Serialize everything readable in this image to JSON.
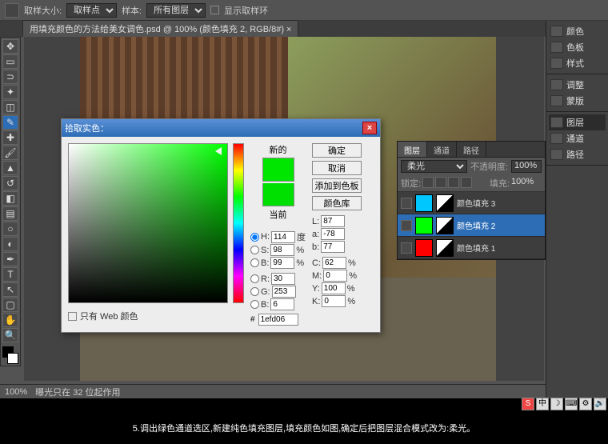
{
  "topbar": {
    "sample_size_label": "取样大小:",
    "sample_size_value": "取样点",
    "sample_label": "样本:",
    "sample_value": "所有图层",
    "show_ring": "显示取样环"
  },
  "doc": {
    "title": "用填充颜色的方法给美女调色.psd @ 100% (颜色填充 2, RGB/8#) ×"
  },
  "right_tabs": {
    "group1": [
      {
        "label": "颜色"
      },
      {
        "label": "色板"
      },
      {
        "label": "样式"
      }
    ],
    "group2": [
      {
        "label": "调整"
      },
      {
        "label": "蒙版"
      }
    ],
    "group3": [
      {
        "label": "图层"
      },
      {
        "label": "通道"
      },
      {
        "label": "路径"
      }
    ]
  },
  "layers_panel": {
    "tabs": [
      "图层",
      "通道",
      "路径"
    ],
    "blend": "柔光",
    "opacity_label": "不透明度:",
    "opacity": "100%",
    "lock_label": "锁定:",
    "fill_label": "填充:",
    "fill": "100%",
    "items": [
      {
        "name": "颜色填充 3",
        "color": "#00c8ff"
      },
      {
        "name": "颜色填充 2",
        "color": "#00ff00",
        "selected": true
      },
      {
        "name": "颜色填充 1",
        "color": "#ff0000"
      }
    ]
  },
  "picker": {
    "title": "拾取实色：",
    "new_label": "新的",
    "current_label": "当前",
    "ok": "确定",
    "cancel": "取消",
    "add_swatch": "添加到色板",
    "libraries": "颜色库",
    "H": {
      "v": "114",
      "u": "度"
    },
    "S": {
      "v": "98",
      "u": "%"
    },
    "B": {
      "v": "99",
      "u": "%"
    },
    "R": {
      "v": "30"
    },
    "G": {
      "v": "253"
    },
    "Bb": {
      "v": "6"
    },
    "L": {
      "v": "87"
    },
    "a": {
      "v": "-78"
    },
    "b": {
      "v": "77"
    },
    "C": {
      "v": "62",
      "u": "%"
    },
    "M": {
      "v": "0",
      "u": "%"
    },
    "Y": {
      "v": "100",
      "u": "%"
    },
    "K": {
      "v": "0",
      "u": "%"
    },
    "web_only": "只有 Web 颜色",
    "hex": "1efd06"
  },
  "status": {
    "zoom": "100%",
    "msg": "曝光只在 32 位起作用"
  },
  "caption": "5.调出绿色通道选区,新建纯色填充图层,填充颜色如图,确定后把图层混合模式改为:柔光。"
}
